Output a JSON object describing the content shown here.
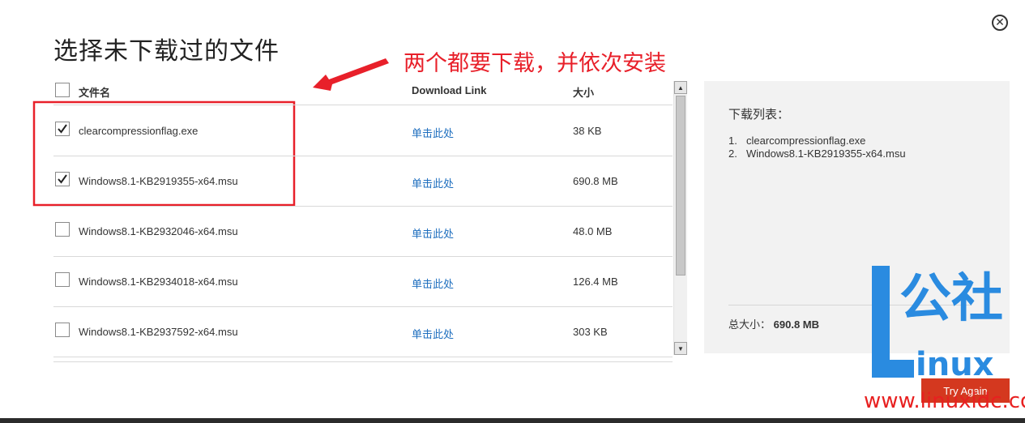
{
  "dialog": {
    "title": "选择未下载过的文件",
    "close_symbol": "✕"
  },
  "annotation": {
    "text": "两个都要下载，并依次安装",
    "color": "#e8202a"
  },
  "table": {
    "headers": {
      "name": "文件名",
      "link": "Download Link",
      "size": "大小"
    },
    "rows": [
      {
        "name": "clearcompressionflag.exe",
        "link": "单击此处",
        "size": "38 KB",
        "checked": true
      },
      {
        "name": "Windows8.1-KB2919355-x64.msu",
        "link": "单击此处",
        "size": "690.8 MB",
        "checked": true
      },
      {
        "name": "Windows8.1-KB2932046-x64.msu",
        "link": "单击此处",
        "size": "48.0 MB",
        "checked": false
      },
      {
        "name": "Windows8.1-KB2934018-x64.msu",
        "link": "单击此处",
        "size": "126.4 MB",
        "checked": false
      },
      {
        "name": "Windows8.1-KB2937592-x64.msu",
        "link": "单击此处",
        "size": "303 KB",
        "checked": false
      }
    ]
  },
  "side_panel": {
    "title": "下载列表：",
    "items": [
      {
        "num": "1.",
        "name": "clearcompressionflag.exe"
      },
      {
        "num": "2.",
        "name": "Windows8.1-KB2919355-x64.msu"
      }
    ],
    "total_label": "总大小：",
    "total_value": "690.8 MB"
  },
  "buttons": {
    "try_again": "Try Again"
  },
  "watermark": {
    "brand": "公社",
    "inux": "inux",
    "url": "www.linuxidc.com"
  },
  "colors": {
    "accent_link": "#1f6fbf",
    "button": "#d4381f",
    "watermark_blue": "#2a8be0",
    "watermark_red": "#e82020"
  }
}
